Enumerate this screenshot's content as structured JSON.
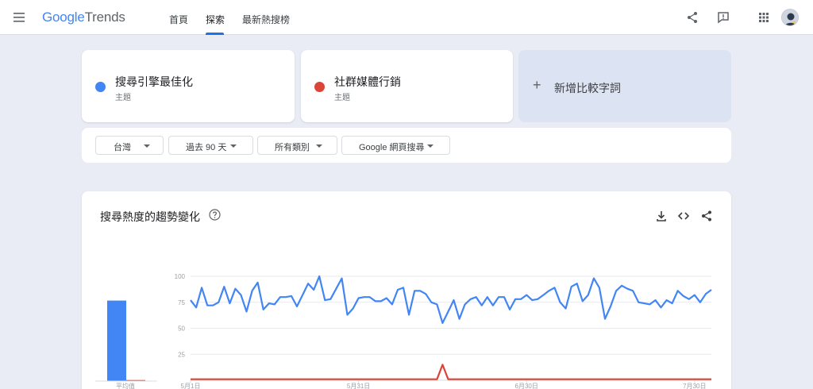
{
  "header": {
    "logo_google": "Google",
    "logo_trends": "Trends",
    "tabs": [
      {
        "label": "首頁"
      },
      {
        "label": "探索"
      },
      {
        "label": "最新熱搜榜"
      }
    ]
  },
  "terms": [
    {
      "name": "搜尋引擎最佳化",
      "type": "主題",
      "color": "#4285f4"
    },
    {
      "name": "社群媒體行銷",
      "type": "主題",
      "color": "#db4437"
    }
  ],
  "add_term": {
    "label": "新增比較字詞",
    "icon": "plus-icon"
  },
  "filters": [
    {
      "label": "台灣"
    },
    {
      "label": "過去 90 天"
    },
    {
      "label": "所有類別"
    },
    {
      "label": "Google 網頁搜尋"
    }
  ],
  "chart_card": {
    "title": "搜尋熱度的趨勢變化",
    "icons": [
      "help-icon",
      "download-icon",
      "embed-icon",
      "share-icon"
    ],
    "avg_label": "平均值"
  },
  "chart_data": {
    "type": "line",
    "ylim": [
      0,
      100
    ],
    "yticks": [
      25,
      50,
      75,
      100
    ],
    "x_tick_labels": [
      "5月1日",
      "5月31日",
      "6月30日",
      "7月30日"
    ],
    "series": [
      {
        "name": "搜尋引擎最佳化",
        "color": "#4285f4",
        "average": 78,
        "values": [
          77,
          70,
          89,
          72,
          72,
          75,
          90,
          74,
          88,
          82,
          66,
          86,
          94,
          68,
          74,
          73,
          80,
          80,
          81,
          71,
          82,
          93,
          87,
          100,
          77,
          78,
          88,
          98,
          63,
          69,
          79,
          80,
          80,
          76,
          76,
          79,
          73,
          87,
          89,
          63,
          86,
          86,
          83,
          75,
          73,
          55,
          66,
          77,
          59,
          73,
          78,
          80,
          72,
          80,
          72,
          80,
          80,
          68,
          78,
          78,
          82,
          77,
          78,
          82,
          86,
          89,
          75,
          69,
          90,
          93,
          76,
          82,
          98,
          89,
          59,
          71,
          86,
          91,
          88,
          86,
          75,
          74,
          73,
          77,
          70,
          77,
          74,
          86,
          81,
          78,
          82,
          75,
          83,
          87
        ]
      },
      {
        "name": "社群媒體行銷",
        "color": "#db4437",
        "average": 1,
        "values": [
          1,
          1,
          1,
          1,
          1,
          1,
          1,
          1,
          1,
          1,
          1,
          1,
          1,
          1,
          1,
          1,
          1,
          1,
          1,
          1,
          1,
          1,
          1,
          1,
          1,
          1,
          1,
          1,
          1,
          1,
          1,
          1,
          1,
          1,
          1,
          1,
          1,
          1,
          1,
          1,
          1,
          1,
          1,
          1,
          1,
          1,
          1,
          1,
          1,
          1,
          1,
          1,
          1,
          1,
          1,
          1,
          1,
          1,
          1,
          1,
          1,
          1,
          1,
          1,
          1,
          1,
          1,
          1,
          1,
          1,
          1,
          1,
          1,
          1,
          1,
          1,
          1,
          1,
          1,
          1,
          1,
          1,
          1,
          1,
          1,
          1,
          1,
          1,
          1,
          1,
          1,
          1,
          1,
          1
        ]
      }
    ],
    "spikes": [
      {
        "series": 1,
        "index": 45,
        "value": 15
      }
    ]
  }
}
